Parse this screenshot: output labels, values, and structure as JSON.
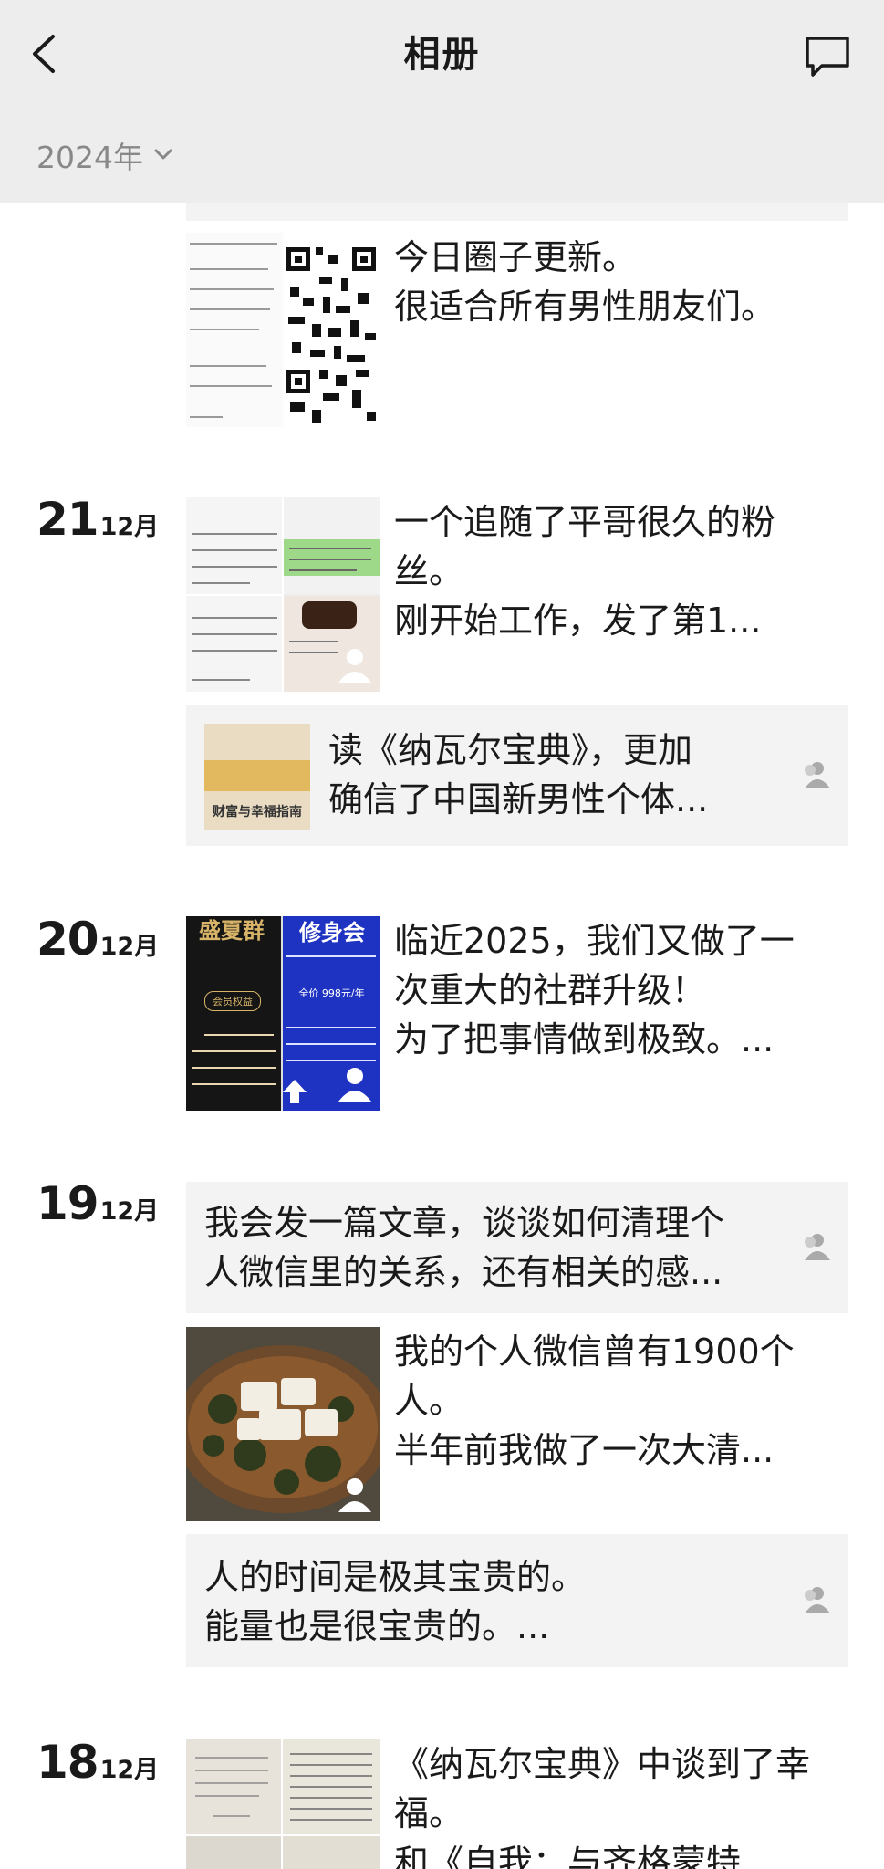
{
  "header": {
    "title": "相册",
    "year": "2024年"
  },
  "top_post": {
    "lines": [
      "今日圈子更新。",
      "很适合所有男性朋友们。"
    ]
  },
  "days": [
    {
      "day": "21",
      "month": "12月",
      "posts": [
        {
          "lines": [
            "一个追随了平哥很久的粉",
            "丝。",
            "刚开始工作，发了第1..."
          ]
        }
      ],
      "card": {
        "book_cover_text": "财富与幸福指南",
        "lines": [
          "读《纳瓦尔宝典》，更加",
          "确信了中国新男性个体..."
        ]
      }
    },
    {
      "day": "20",
      "month": "12月",
      "posts": [
        {
          "lines": [
            "临近2025，我们又做了一",
            "次重大的社群升级！",
            "为了把事情做到极致。..."
          ],
          "poster_left": "盛夏群",
          "poster_right": "修身会",
          "poster_price": "全价 998元/年",
          "poster_badge": "会员权益"
        }
      ]
    },
    {
      "day": "19",
      "month": "12月",
      "card_top": {
        "lines": [
          "我会发一篇文章，谈谈如何清理个",
          "人微信里的关系，还有相关的感..."
        ]
      },
      "posts": [
        {
          "lines": [
            "我的个人微信曾有1900个",
            "人。",
            "半年前我做了一次大清..."
          ]
        }
      ],
      "card_bottom": {
        "lines": [
          "人的时间是极其宝贵的。",
          "能量也是很宝贵的。..."
        ]
      }
    },
    {
      "day": "18",
      "month": "12月",
      "posts": [
        {
          "lines": [
            "《纳瓦尔宝典》中谈到了幸",
            "福。",
            "和《自我：与齐格蒙特..."
          ]
        }
      ]
    }
  ],
  "colors": {
    "header_bg": "#ededed",
    "card_bg": "#f3f3f3",
    "text": "#1a1a1a",
    "muted": "#888888"
  }
}
